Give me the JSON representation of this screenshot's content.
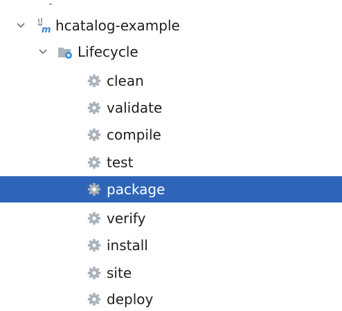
{
  "tree": {
    "project": {
      "label": "hcatalog-example",
      "icon": "maven-module-icon",
      "expanded": true
    },
    "lifecycle": {
      "label": "Lifecycle",
      "icon": "lifecycle-folder-icon",
      "expanded": true
    },
    "goals": [
      {
        "label": "clean",
        "icon": "gear-icon",
        "selected": false
      },
      {
        "label": "validate",
        "icon": "gear-icon",
        "selected": false
      },
      {
        "label": "compile",
        "icon": "gear-icon",
        "selected": false
      },
      {
        "label": "test",
        "icon": "gear-icon",
        "selected": false
      },
      {
        "label": "package",
        "icon": "gear-icon",
        "selected": true
      },
      {
        "label": "verify",
        "icon": "gear-icon",
        "selected": false
      },
      {
        "label": "install",
        "icon": "gear-icon",
        "selected": false
      },
      {
        "label": "site",
        "icon": "gear-icon",
        "selected": false
      },
      {
        "label": "deploy",
        "icon": "gear-icon",
        "selected": false
      }
    ]
  },
  "colors": {
    "selection": "#2f65b9",
    "text": "#1e1e1e",
    "gear": "#a9b1b9",
    "maven_m": "#3d7fd1"
  }
}
